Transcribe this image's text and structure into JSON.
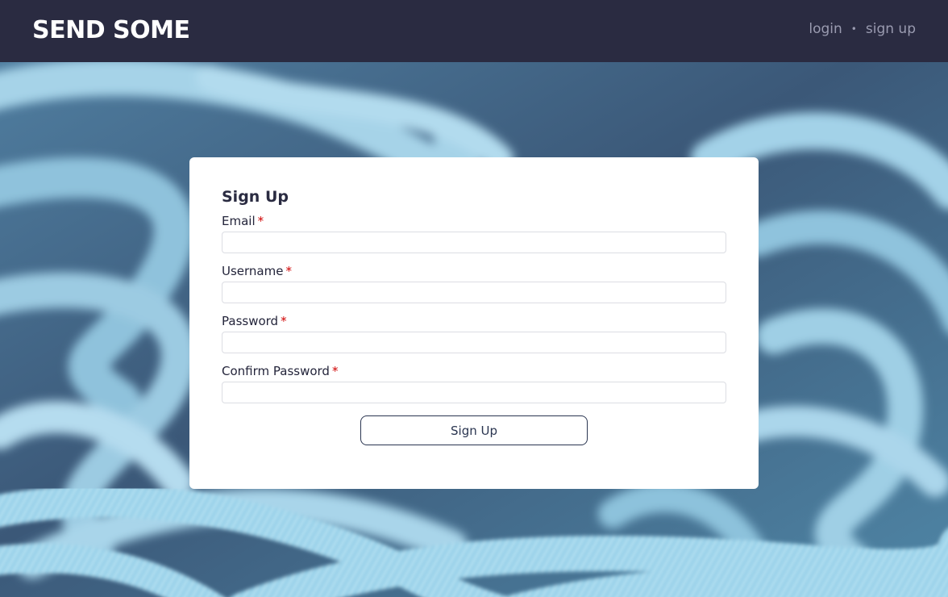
{
  "header": {
    "brand": "SEND SOME",
    "nav": {
      "login": "login",
      "separator": "•",
      "signup": "sign up"
    }
  },
  "form": {
    "title": "Sign Up",
    "required_marker": "*",
    "fields": [
      {
        "label": "Email",
        "value": "",
        "type": "email"
      },
      {
        "label": "Username",
        "value": "",
        "type": "text"
      },
      {
        "label": "Password",
        "value": "",
        "type": "password"
      },
      {
        "label": "Confirm Password",
        "value": "",
        "type": "password"
      }
    ],
    "submit_label": "Sign Up"
  },
  "colors": {
    "header_bg": "#2a2b41",
    "brand": "#ffffff",
    "nav_text": "#9a9bb0",
    "required": "#d00000",
    "button_border": "#2a3550",
    "rope": "#9ccfe6"
  },
  "background": {
    "subject": "blue climbing ropes"
  }
}
